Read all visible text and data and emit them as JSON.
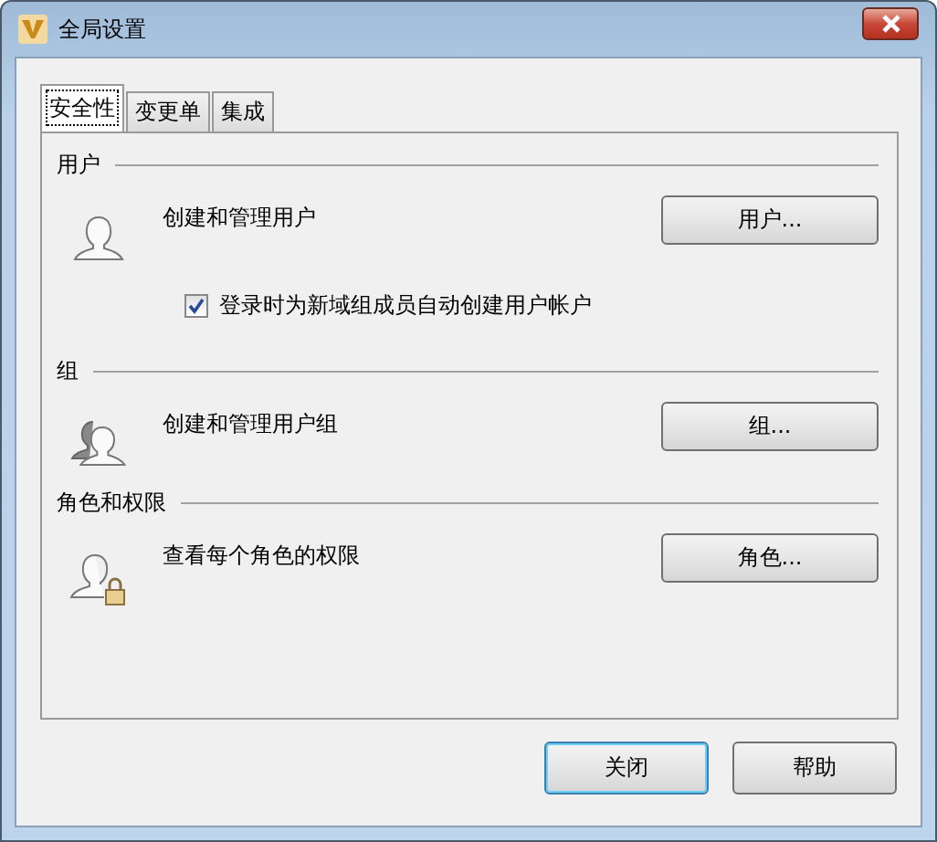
{
  "window": {
    "title": "全局设置"
  },
  "tabs": [
    {
      "label": "安全性",
      "selected": true
    },
    {
      "label": "变更单",
      "selected": false
    },
    {
      "label": "集成",
      "selected": false
    }
  ],
  "sections": [
    {
      "heading": "用户",
      "kind": "user",
      "description": "创建和管理用户",
      "button": "用户...",
      "checkbox": {
        "label": "登录时为新域组成员自动创建用户帐户",
        "checked": true
      }
    },
    {
      "heading": "组",
      "kind": "group",
      "description": "创建和管理用户组",
      "button": "组..."
    },
    {
      "heading": "角色和权限",
      "kind": "user-lock",
      "description": "查看每个角色的权限",
      "button": "角色..."
    }
  ],
  "buttons": [
    {
      "label": "关闭",
      "default": true
    },
    {
      "label": "帮助",
      "default": false
    }
  ]
}
